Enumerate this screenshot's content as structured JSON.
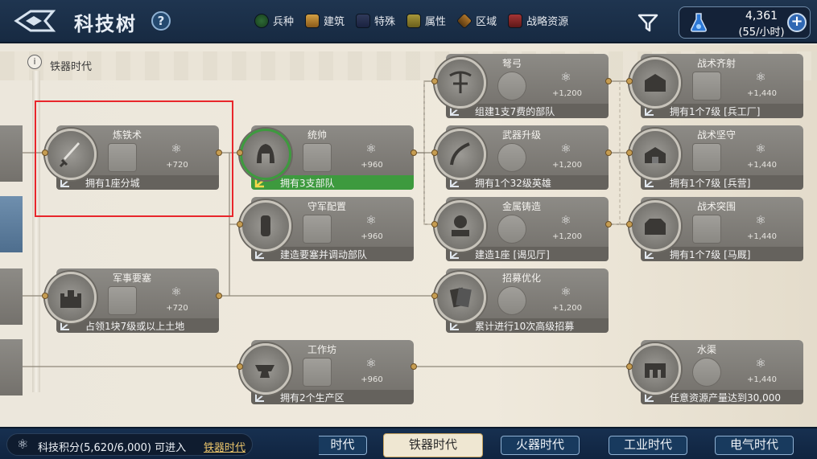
{
  "header": {
    "title": "科技树",
    "help_label": "?",
    "legend": [
      {
        "label": "兵种",
        "icon": "unit-swatch-icon"
      },
      {
        "label": "建筑",
        "icon": "building-swatch-icon"
      },
      {
        "label": "特殊",
        "icon": "special-swatch-icon"
      },
      {
        "label": "属性",
        "icon": "attribute-swatch-icon"
      },
      {
        "label": "区域",
        "icon": "region-swatch-icon"
      },
      {
        "label": "战略资源",
        "icon": "strategic-resource-swatch-icon"
      }
    ],
    "resource": {
      "amount": "4,361",
      "rate": "(55/小时)"
    },
    "plus_label": "+"
  },
  "era": {
    "label": "铁器时代",
    "info": "i"
  },
  "cards": [
    {
      "id": "smelting",
      "name": "炼铁术",
      "cost": "+720",
      "condition": "拥有1座分城",
      "icon": "sword-icon"
    },
    {
      "id": "commander",
      "name": "统帅",
      "cost": "+960",
      "condition": "拥有3支部队",
      "icon": "helmet-icon"
    },
    {
      "id": "garrison",
      "name": "守军配置",
      "cost": "+960",
      "condition": "建造要塞并调动部队",
      "icon": "soldier-icon"
    },
    {
      "id": "fortress",
      "name": "军事要塞",
      "cost": "+720",
      "condition": "占领1块7级或以上土地",
      "icon": "fortress-icon"
    },
    {
      "id": "workshop",
      "name": "工作坊",
      "cost": "+960",
      "condition": "拥有2个生产区",
      "icon": "anvil-icon"
    },
    {
      "id": "crossbow",
      "name": "弩弓",
      "cost": "+1,200",
      "condition": "组建1支7费的部队",
      "icon": "crossbow-icon"
    },
    {
      "id": "weapon-up",
      "name": "武器升级",
      "cost": "+1,200",
      "condition": "拥有1个32级英雄",
      "icon": "sabre-icon"
    },
    {
      "id": "metal-cast",
      "name": "金属铸造",
      "cost": "+1,200",
      "condition": "建造1座 [谒见厅]",
      "icon": "statue-icon"
    },
    {
      "id": "recruit",
      "name": "招募优化",
      "cost": "+1,200",
      "condition": "累计进行10次高级招募",
      "icon": "cards-icon"
    },
    {
      "id": "volley",
      "name": "战术齐射",
      "cost": "+1,440",
      "condition": "拥有1个7级 [兵工厂]",
      "icon": "armory-icon"
    },
    {
      "id": "hold",
      "name": "战术坚守",
      "cost": "+1,440",
      "condition": "拥有1个7级 [兵营]",
      "icon": "barracks-icon"
    },
    {
      "id": "breach",
      "name": "战术突围",
      "cost": "+1,440",
      "condition": "拥有1个7级 [马厩]",
      "icon": "stable-icon"
    },
    {
      "id": "aqueduct",
      "name": "水渠",
      "cost": "+1,440",
      "condition": "任意资源产量达到30,000",
      "icon": "aqueduct-icon"
    }
  ],
  "footer": {
    "score_text": "科技积分(5,620/6,000)  可进入",
    "score_link": "铁器时代",
    "eras": [
      "时代",
      "铁器时代",
      "火器时代",
      "工业时代",
      "电气时代"
    ]
  }
}
